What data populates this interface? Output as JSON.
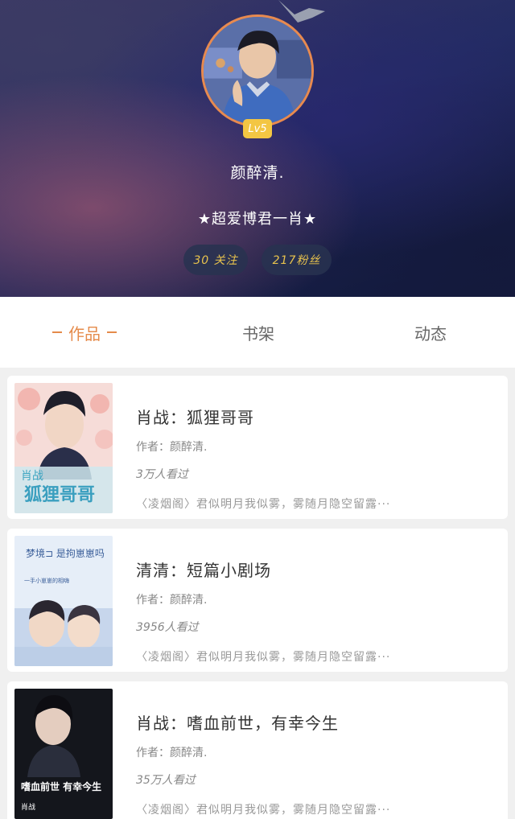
{
  "profile": {
    "level": "Lv5",
    "username": "颜醉清.",
    "bio": "★超爱博君一肖★",
    "following": "30 关注",
    "fans": "217粉丝"
  },
  "tabs": [
    {
      "label": "作品",
      "active": true
    },
    {
      "label": "书架",
      "active": false
    },
    {
      "label": "动态",
      "active": false
    }
  ],
  "colors": {
    "accent": "#e58b4b",
    "badge": "#f3c643",
    "stat_text": "#e7c24d"
  },
  "books": [
    {
      "title": "肖战：狐狸哥哥",
      "author": "作者：颜醉清.",
      "views": "3万人看过",
      "excerpt": "〈凌烟阁〉君似明月我似雾，雾随月隐空留露···",
      "cover_text": "狐狸哥哥",
      "cover_tag": "肖战"
    },
    {
      "title": "清清：短篇小剧场",
      "author": "作者：颜醉清.",
      "views": "3956人看过",
      "excerpt": "〈凌烟阁〉君似明月我似雾，雾随月隐空留露···",
      "cover_text": "梦境⊐ 是拘崽崽吗",
      "cover_tag": "一手小崽崽的相嗨"
    },
    {
      "title": "肖战：嗜血前世，有幸今生",
      "author": "作者：颜醉清.",
      "views": "35万人看过",
      "excerpt": "〈凌烟阁〉君似明月我似雾，雾随月隐空留露···",
      "cover_text": "嗜血前世 有幸今生",
      "cover_tag": "肖战"
    }
  ]
}
